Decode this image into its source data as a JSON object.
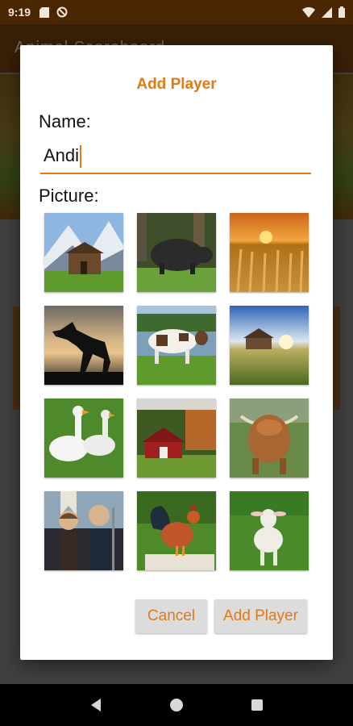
{
  "status_bar": {
    "time": "9:19"
  },
  "background_app": {
    "title": "Animal Scoreboard"
  },
  "dialog": {
    "title": "Add Player",
    "name_label": "Name:",
    "name_value": "Andi",
    "picture_label": "Picture:",
    "pictures": [
      "cabin-mountains",
      "black-pig",
      "wheat-field",
      "rearing-horse-silhouette",
      "dairy-cow",
      "barn-sunrise",
      "white-geese",
      "red-barn",
      "highland-cow",
      "american-gothic",
      "rooster",
      "lamb"
    ],
    "cancel_label": "Cancel",
    "add_label": "Add Player"
  },
  "colors": {
    "accent": "#e07a12",
    "status_bar": "#4a2603"
  }
}
